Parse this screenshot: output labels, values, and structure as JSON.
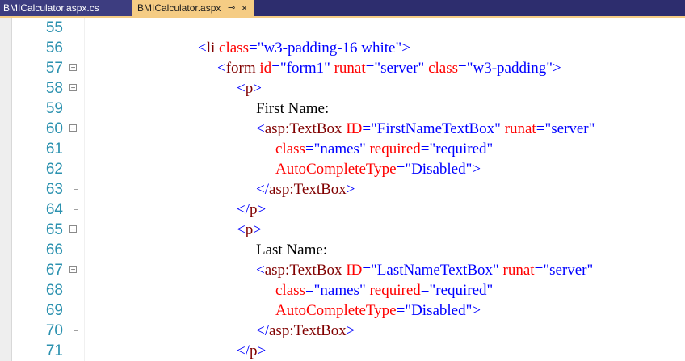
{
  "tabs": [
    {
      "label": "BMICalculator.aspx.cs",
      "active": false
    },
    {
      "label": "BMICalculator.aspx",
      "active": true,
      "pin_icon": "pin-icon",
      "close_icon": "close-icon"
    }
  ],
  "tab_icons": {
    "pin": "⊸",
    "close": "×"
  },
  "colors": {
    "tab_bar": "#2d2d6e",
    "active_tab": "#f5cc84",
    "line_number": "#2b91af",
    "tag": "#800000",
    "delimiter": "#0000ff",
    "attribute": "#ff0000",
    "value": "#0000ff"
  },
  "lines": [
    {
      "num": "55",
      "indent": 0,
      "fold": "",
      "tokens": []
    },
    {
      "num": "56",
      "indent": 0,
      "fold": "",
      "tokens": [
        {
          "t": "delim",
          "v": "<"
        },
        {
          "t": "tag",
          "v": "li"
        },
        {
          "t": "text",
          "v": " "
        },
        {
          "t": "attr",
          "v": "class"
        },
        {
          "t": "delim",
          "v": "="
        },
        {
          "t": "val",
          "v": "\"w3-padding-16 white\""
        },
        {
          "t": "delim",
          "v": ">"
        }
      ]
    },
    {
      "num": "57",
      "indent": 1,
      "fold": "open",
      "tokens": [
        {
          "t": "delim",
          "v": "<"
        },
        {
          "t": "tag",
          "v": "form"
        },
        {
          "t": "text",
          "v": " "
        },
        {
          "t": "attr",
          "v": "id"
        },
        {
          "t": "delim",
          "v": "="
        },
        {
          "t": "val",
          "v": "\"form1\""
        },
        {
          "t": "text",
          "v": " "
        },
        {
          "t": "attr",
          "v": "runat"
        },
        {
          "t": "delim",
          "v": "="
        },
        {
          "t": "val",
          "v": "\"server\""
        },
        {
          "t": "text",
          "v": " "
        },
        {
          "t": "attr",
          "v": "class"
        },
        {
          "t": "delim",
          "v": "="
        },
        {
          "t": "val",
          "v": "\"w3-padding\""
        },
        {
          "t": "delim",
          "v": ">"
        }
      ]
    },
    {
      "num": "58",
      "indent": 2,
      "fold": "open",
      "tokens": [
        {
          "t": "delim",
          "v": "<"
        },
        {
          "t": "tag",
          "v": "p"
        },
        {
          "t": "delim",
          "v": ">"
        }
      ]
    },
    {
      "num": "59",
      "indent": 3,
      "fold": "",
      "tokens": [
        {
          "t": "text",
          "v": "First Name:"
        }
      ]
    },
    {
      "num": "60",
      "indent": 3,
      "fold": "open",
      "tokens": [
        {
          "t": "delim",
          "v": "<"
        },
        {
          "t": "tag",
          "v": "asp:TextBox"
        },
        {
          "t": "text",
          "v": " "
        },
        {
          "t": "attr",
          "v": "ID"
        },
        {
          "t": "delim",
          "v": "="
        },
        {
          "t": "val",
          "v": "\"FirstNameTextBox\""
        },
        {
          "t": "text",
          "v": " "
        },
        {
          "t": "attr",
          "v": "runat"
        },
        {
          "t": "delim",
          "v": "="
        },
        {
          "t": "val",
          "v": "\"server\""
        }
      ]
    },
    {
      "num": "61",
      "indent": 4,
      "fold": "",
      "tokens": [
        {
          "t": "attr",
          "v": "class"
        },
        {
          "t": "delim",
          "v": "="
        },
        {
          "t": "val",
          "v": "\"names\""
        },
        {
          "t": "text",
          "v": " "
        },
        {
          "t": "attr",
          "v": "required"
        },
        {
          "t": "delim",
          "v": "="
        },
        {
          "t": "val",
          "v": "\"required\""
        }
      ]
    },
    {
      "num": "62",
      "indent": 4,
      "fold": "",
      "tokens": [
        {
          "t": "attr",
          "v": "AutoCompleteType"
        },
        {
          "t": "delim",
          "v": "="
        },
        {
          "t": "val",
          "v": "\"Disabled\""
        },
        {
          "t": "delim",
          "v": ">"
        }
      ]
    },
    {
      "num": "63",
      "indent": 3,
      "fold": "end",
      "tokens": [
        {
          "t": "delim",
          "v": "</"
        },
        {
          "t": "tag",
          "v": "asp:TextBox"
        },
        {
          "t": "delim",
          "v": ">"
        }
      ]
    },
    {
      "num": "64",
      "indent": 2,
      "fold": "end",
      "tokens": [
        {
          "t": "delim",
          "v": "</"
        },
        {
          "t": "tag",
          "v": "p"
        },
        {
          "t": "delim",
          "v": ">"
        }
      ]
    },
    {
      "num": "65",
      "indent": 2,
      "fold": "open",
      "tokens": [
        {
          "t": "delim",
          "v": "<"
        },
        {
          "t": "tag",
          "v": "p"
        },
        {
          "t": "delim",
          "v": ">"
        }
      ]
    },
    {
      "num": "66",
      "indent": 3,
      "fold": "",
      "tokens": [
        {
          "t": "text",
          "v": "Last Name:"
        }
      ]
    },
    {
      "num": "67",
      "indent": 3,
      "fold": "open",
      "tokens": [
        {
          "t": "delim",
          "v": "<"
        },
        {
          "t": "tag",
          "v": "asp:TextBox"
        },
        {
          "t": "text",
          "v": " "
        },
        {
          "t": "attr",
          "v": "ID"
        },
        {
          "t": "delim",
          "v": "="
        },
        {
          "t": "val",
          "v": "\"LastNameTextBox\""
        },
        {
          "t": "text",
          "v": " "
        },
        {
          "t": "attr",
          "v": "runat"
        },
        {
          "t": "delim",
          "v": "="
        },
        {
          "t": "val",
          "v": "\"server\""
        }
      ]
    },
    {
      "num": "68",
      "indent": 4,
      "fold": "",
      "tokens": [
        {
          "t": "attr",
          "v": "class"
        },
        {
          "t": "delim",
          "v": "="
        },
        {
          "t": "val",
          "v": "\"names\""
        },
        {
          "t": "text",
          "v": " "
        },
        {
          "t": "attr",
          "v": "required"
        },
        {
          "t": "delim",
          "v": "="
        },
        {
          "t": "val",
          "v": "\"required\""
        }
      ]
    },
    {
      "num": "69",
      "indent": 4,
      "fold": "",
      "tokens": [
        {
          "t": "attr",
          "v": "AutoCompleteType"
        },
        {
          "t": "delim",
          "v": "="
        },
        {
          "t": "val",
          "v": "\"Disabled\""
        },
        {
          "t": "delim",
          "v": ">"
        }
      ]
    },
    {
      "num": "70",
      "indent": 3,
      "fold": "end",
      "tokens": [
        {
          "t": "delim",
          "v": "</"
        },
        {
          "t": "tag",
          "v": "asp:TextBox"
        },
        {
          "t": "delim",
          "v": ">"
        }
      ]
    },
    {
      "num": "71",
      "indent": 2,
      "fold": "end",
      "tokens": [
        {
          "t": "delim",
          "v": "</"
        },
        {
          "t": "tag",
          "v": "p"
        },
        {
          "t": "delim",
          "v": ">"
        }
      ]
    }
  ]
}
